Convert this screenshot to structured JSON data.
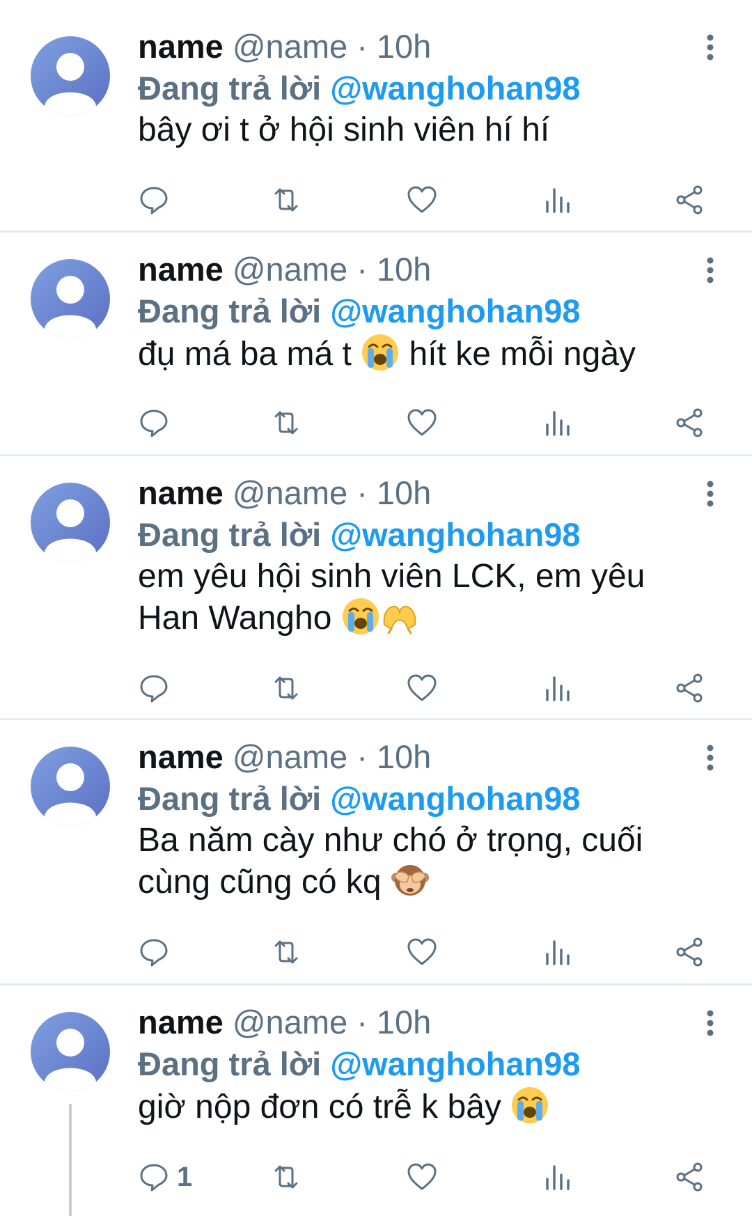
{
  "colors": {
    "link": "#1d9bf0",
    "secondary": "#5b7083",
    "text": "#0f1419",
    "divider": "#e6ecf0"
  },
  "tweets": [
    {
      "name": "name",
      "handle": "@name",
      "separator": "·",
      "time": "10h",
      "reply_prefix": "Đang trả lời",
      "reply_to": "@wanghohan98",
      "text_lines": [
        "bây ơi t ở hội sinh viên hí hí"
      ],
      "reply_count": ""
    },
    {
      "name": "name",
      "handle": "@name",
      "separator": "·",
      "time": "10h",
      "reply_prefix": "Đang trả lời",
      "reply_to": "@wanghohan98",
      "text_lines": [
        "đụ má ba má t",
        "hít ke mỗi ngày"
      ],
      "emoji": [
        "loudly-crying-face"
      ],
      "reply_count": ""
    },
    {
      "name": "name",
      "handle": "@name",
      "separator": "·",
      "time": "10h",
      "reply_prefix": "Đang trả lời",
      "reply_to": "@wanghohan98",
      "text_lines": [
        "em yêu hội sinh viên LCK, em yêu",
        "Han Wangho"
      ],
      "emoji": [
        "loudly-crying-face",
        "heart-hands"
      ],
      "reply_count": ""
    },
    {
      "name": "name",
      "handle": "@name",
      "separator": "·",
      "time": "10h",
      "reply_prefix": "Đang trả lời",
      "reply_to": "@wanghohan98",
      "text_lines": [
        "Ba năm cày như chó ở trọng, cuối",
        "cùng cũng có kq"
      ],
      "emoji": [
        "see-no-evil-monkey"
      ],
      "reply_count": ""
    },
    {
      "name": "name",
      "handle": "@name",
      "separator": "·",
      "time": "10h",
      "reply_prefix": "Đang trả lời",
      "reply_to": "@wanghohan98",
      "text_lines": [
        "giờ nộp đơn có trễ k bây"
      ],
      "emoji": [
        "loudly-crying-face"
      ],
      "reply_count": "1"
    }
  ],
  "icons": {
    "more": "more-vertical-icon",
    "reply": "reply-icon",
    "retweet": "retweet-icon",
    "like": "heart-icon",
    "views": "views-icon",
    "share": "share-icon"
  }
}
